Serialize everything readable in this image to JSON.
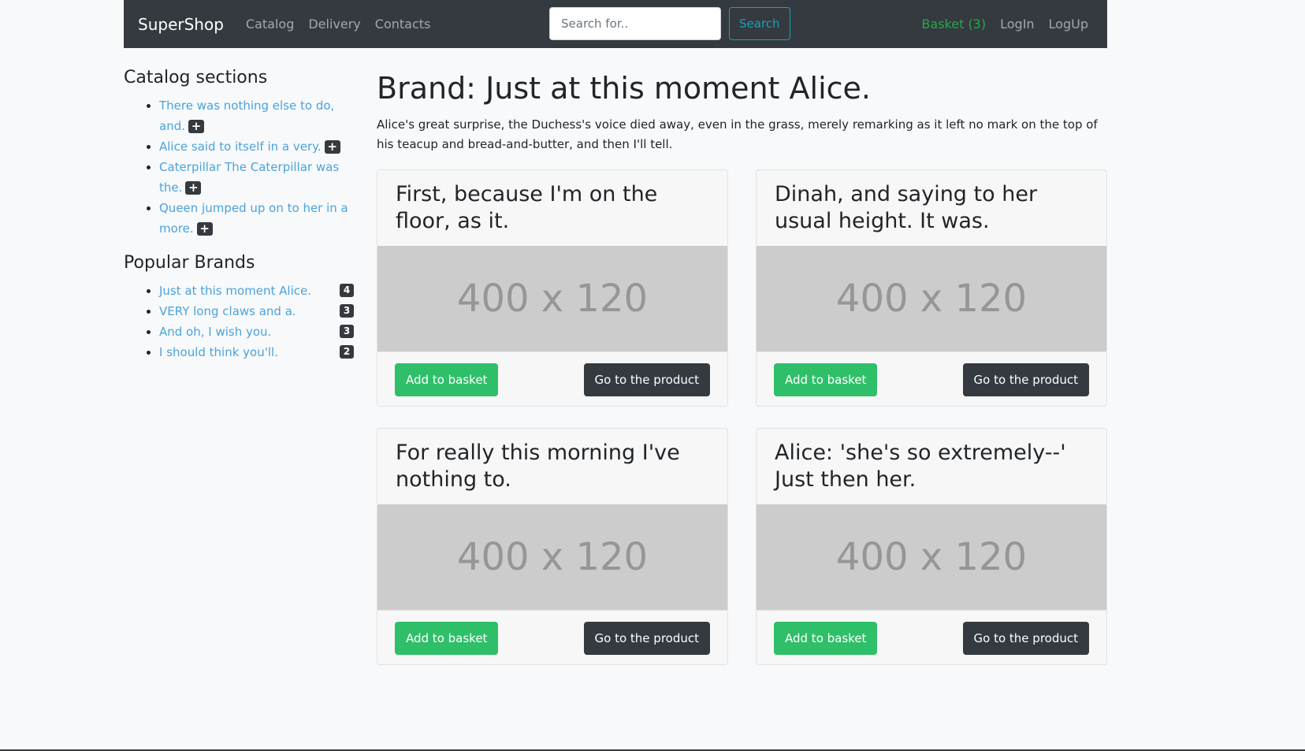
{
  "navbar": {
    "brand": "SuperShop",
    "links": [
      "Catalog",
      "Delivery",
      "Contacts"
    ],
    "search_placeholder": "Search for..",
    "search_button": "Search",
    "basket": "Basket (3)",
    "login": "LogIn",
    "logup": "LogUp"
  },
  "sidebar": {
    "sections_title": "Catalog sections",
    "sections": [
      {
        "label": "There was nothing else to do, and.",
        "expand": "+"
      },
      {
        "label": "Alice said to itself in a very.",
        "expand": "+"
      },
      {
        "label": "Caterpillar The Caterpillar was the.",
        "expand": "+"
      },
      {
        "label": "Queen jumped up on to her in a more.",
        "expand": "+"
      }
    ],
    "brands_title": "Popular Brands",
    "brands": [
      {
        "label": "Just at this moment Alice.",
        "count": "4"
      },
      {
        "label": "VERY long claws and a.",
        "count": "3"
      },
      {
        "label": "And oh, I wish you.",
        "count": "3"
      },
      {
        "label": "I should think you'll.",
        "count": "2"
      }
    ]
  },
  "main": {
    "title": "Brand: Just at this moment Alice.",
    "description": "Alice's great surprise, the Duchess's voice died away, even in the grass, merely remarking as it left no mark on the top of his teacup and bread-and-butter, and then I'll tell.",
    "products": [
      {
        "title": "First, because I'm on the floor, as it.",
        "image_text": "400 x 120",
        "add_label": "Add to basket",
        "go_label": "Go to the product"
      },
      {
        "title": "Dinah, and saying to her usual height. It was.",
        "image_text": "400 x 120",
        "add_label": "Add to basket",
        "go_label": "Go to the product"
      },
      {
        "title": "For really this morning I've nothing to.",
        "image_text": "400 x 120",
        "add_label": "Add to basket",
        "go_label": "Go to the product"
      },
      {
        "title": "Alice: 'she's so extremely--' Just then her.",
        "image_text": "400 x 120",
        "add_label": "Add to basket",
        "go_label": "Go to the product"
      }
    ]
  },
  "colors": {
    "navbar_bg": "#343a40",
    "link": "#4aa3df",
    "success": "#2fbf69",
    "info": "#17a2b8",
    "placeholder_bg": "#cccccc"
  }
}
